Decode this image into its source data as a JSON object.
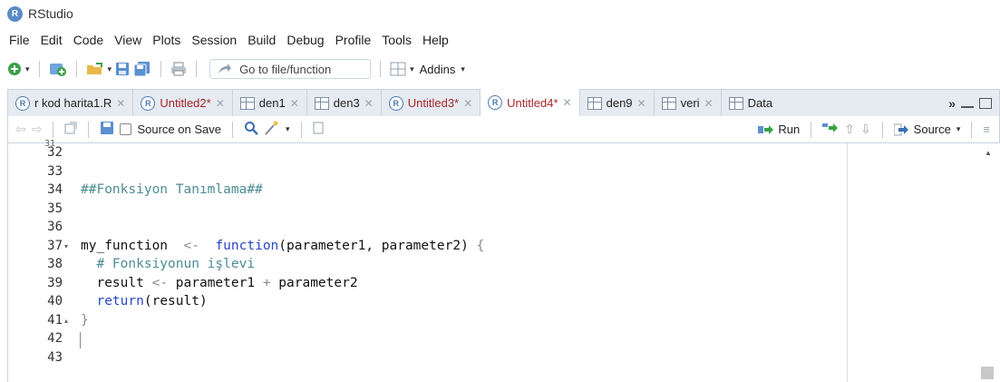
{
  "window": {
    "title": "RStudio"
  },
  "menu": [
    "File",
    "Edit",
    "Code",
    "View",
    "Plots",
    "Session",
    "Build",
    "Debug",
    "Profile",
    "Tools",
    "Help"
  ],
  "toolbar": {
    "goto_placeholder": "Go to file/function",
    "addins_label": "Addins"
  },
  "tabs": [
    {
      "label": "r kod harita1.R",
      "icon": "r-file-icon",
      "modified": false,
      "active": false
    },
    {
      "label": "Untitled2*",
      "icon": "r-file-icon",
      "modified": true,
      "active": false
    },
    {
      "label": "den1",
      "icon": "data-grid-icon",
      "modified": false,
      "active": false
    },
    {
      "label": "den3",
      "icon": "data-grid-icon",
      "modified": false,
      "active": false
    },
    {
      "label": "Untitled3*",
      "icon": "r-file-icon",
      "modified": true,
      "active": false
    },
    {
      "label": "Untitled4*",
      "icon": "r-file-icon",
      "modified": true,
      "active": true
    },
    {
      "label": "den9",
      "icon": "data-grid-icon",
      "modified": false,
      "active": false
    },
    {
      "label": "veri",
      "icon": "data-grid-icon",
      "modified": false,
      "active": false
    },
    {
      "label": "Data",
      "icon": "data-grid-icon",
      "modified": false,
      "active": false
    }
  ],
  "editor_toolbar": {
    "source_on_save": "Source on Save",
    "run": "Run",
    "source": "Source"
  },
  "editor": {
    "top_partial_line": "31",
    "lines": [
      {
        "num": "32",
        "tokens": []
      },
      {
        "num": "33",
        "tokens": []
      },
      {
        "num": "34",
        "tokens": [
          {
            "t": "##Fonksiyon Tanımlama##",
            "c": "comment"
          }
        ]
      },
      {
        "num": "35",
        "tokens": []
      },
      {
        "num": "36",
        "tokens": []
      },
      {
        "num": "37",
        "fold": "▾",
        "tokens": [
          {
            "t": "my_function  ",
            "c": "plain"
          },
          {
            "t": "<-",
            "c": "op"
          },
          {
            "t": "  ",
            "c": "plain"
          },
          {
            "t": "function",
            "c": "kw"
          },
          {
            "t": "(parameter1, parameter2) ",
            "c": "plain"
          },
          {
            "t": "{",
            "c": "op"
          }
        ]
      },
      {
        "num": "38",
        "tokens": [
          {
            "t": "  # Fonksiyonun işlevi",
            "c": "comment"
          }
        ]
      },
      {
        "num": "39",
        "tokens": [
          {
            "t": "  result ",
            "c": "plain"
          },
          {
            "t": "<-",
            "c": "op"
          },
          {
            "t": " parameter1 ",
            "c": "plain"
          },
          {
            "t": "+",
            "c": "op"
          },
          {
            "t": " parameter2",
            "c": "plain"
          }
        ]
      },
      {
        "num": "40",
        "tokens": [
          {
            "t": "  ",
            "c": "plain"
          },
          {
            "t": "return",
            "c": "kw"
          },
          {
            "t": "(result)",
            "c": "plain"
          }
        ]
      },
      {
        "num": "41",
        "fold": "▴",
        "tokens": [
          {
            "t": "}",
            "c": "op"
          }
        ]
      },
      {
        "num": "42",
        "tokens": []
      },
      {
        "num": "43",
        "tokens": []
      }
    ]
  }
}
